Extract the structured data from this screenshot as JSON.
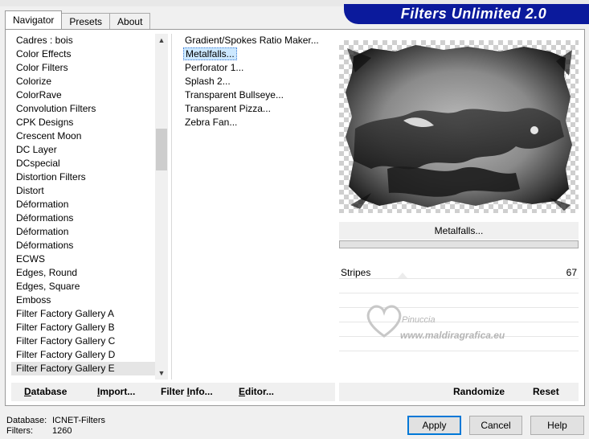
{
  "tabs": [
    "Navigator",
    "Presets",
    "About"
  ],
  "banner_title": "Filters Unlimited 2.0",
  "categories": [
    "Cadres : bois",
    "Color Effects",
    "Color Filters",
    "Colorize",
    "ColorRave",
    "Convolution Filters",
    "CPK Designs",
    "Crescent Moon",
    "DC Layer",
    "DCspecial",
    "Distortion Filters",
    "Distort",
    "Déformation",
    "Déformations",
    "Déformation",
    "Déformations",
    "ECWS",
    "Edges, Round",
    "Edges, Square",
    "Emboss",
    "Filter Factory Gallery A",
    "Filter Factory Gallery B",
    "Filter Factory Gallery C",
    "Filter Factory Gallery D",
    "Filter Factory Gallery E"
  ],
  "selected_category": "Filter Factory Gallery E",
  "filters": [
    "Gradient/Spokes Ratio Maker...",
    "Metalfalls...",
    "Perforator 1...",
    "Splash 2...",
    "Transparent Bullseye...",
    "Transparent Pizza...",
    "Zebra Fan..."
  ],
  "selected_filter": "Metalfalls...",
  "filter_name_display": "Metalfalls...",
  "slider": {
    "name": "Stripes",
    "value": "67"
  },
  "watermark": {
    "line1": "Pinuccia",
    "line2": "www.maldiragrafica.eu"
  },
  "bottom_left_buttons": [
    {
      "label": "Database",
      "underline": "D"
    },
    {
      "label": "Import...",
      "underline": "I"
    },
    {
      "label": "Filter Info...",
      "underline": "F"
    },
    {
      "label": "Editor...",
      "underline": "E"
    }
  ],
  "randomize_label": "Randomize",
  "reset_label": "Reset",
  "info": {
    "database_key": "Database:",
    "database_value": "ICNET-Filters",
    "filters_key": "Filters:",
    "filters_value": "1260"
  },
  "dialog_buttons": {
    "apply": "Apply",
    "cancel": "Cancel",
    "help": "Help"
  },
  "colors": {
    "banner": "#0b1a9c",
    "selection": "#cce8ff",
    "default_button_border": "#0078d7"
  }
}
